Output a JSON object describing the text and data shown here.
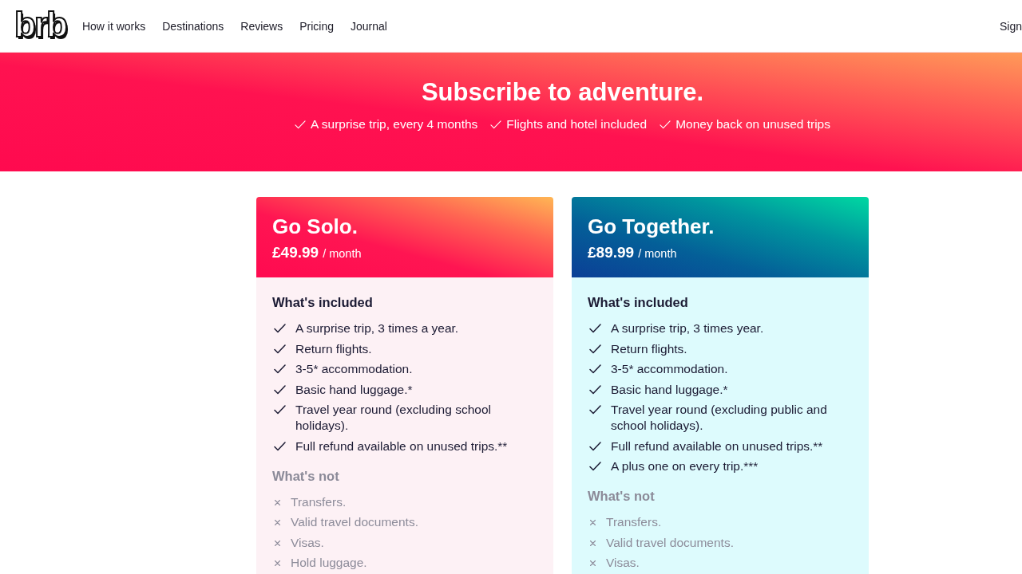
{
  "nav": {
    "logo": "brb",
    "links": [
      "How it works",
      "Destinations",
      "Reviews",
      "Pricing",
      "Journal"
    ],
    "sign_in": "Sign"
  },
  "hero": {
    "title": "Subscribe to adventure.",
    "features": [
      "A surprise trip, every 4 months",
      "Flights and hotel included",
      "Money back on unused trips"
    ]
  },
  "plans": [
    {
      "kind": "solo",
      "name": "Go Solo.",
      "price": "£49.99",
      "period": "/ month",
      "included_heading": "What's included",
      "included": [
        "A surprise trip, 3 times a year.",
        "Return flights.",
        "3-5* accommodation.",
        "Basic hand luggage.*",
        "Travel year round (excluding school holidays).",
        "Full refund available on unused trips.**"
      ],
      "excluded_heading": "What's not",
      "excluded": [
        "Transfers.",
        "Valid travel documents.",
        "Visas.",
        "Hold luggage."
      ]
    },
    {
      "kind": "together",
      "name": "Go Together.",
      "price": "£89.99",
      "period": "/ month",
      "included_heading": "What's included",
      "included": [
        "A surprise trip, 3 times year.",
        "Return flights.",
        "3-5* accommodation.",
        "Basic hand luggage.*",
        "Travel year round (excluding public and school holidays).",
        "Full refund available on unused trips.**",
        "A plus one on every trip.***"
      ],
      "excluded_heading": "What's not",
      "excluded": [
        "Transfers.",
        "Valid travel documents.",
        "Visas."
      ]
    }
  ]
}
